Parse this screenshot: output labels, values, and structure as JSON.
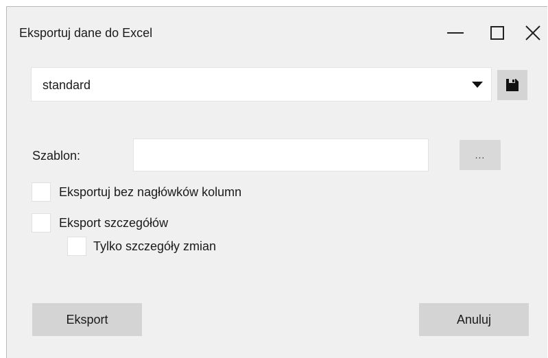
{
  "window": {
    "title": "Eksportuj dane do Excel"
  },
  "profile": {
    "selected": "standard"
  },
  "template": {
    "label": "Szablon:",
    "value": "",
    "browse_label": "..."
  },
  "options": {
    "no_headers_label": "Eksportuj bez nagłówków kolumn",
    "export_details_label": "Eksport szczegółów",
    "only_changes_label": "Tylko szczegóły zmian"
  },
  "actions": {
    "export_label": "Eksport",
    "cancel_label": "Anuluj"
  },
  "icons": {
    "minimize": "minimize-icon",
    "maximize": "maximize-icon",
    "close": "close-icon",
    "save": "save-icon",
    "dropdown": "chevron-down-icon"
  }
}
